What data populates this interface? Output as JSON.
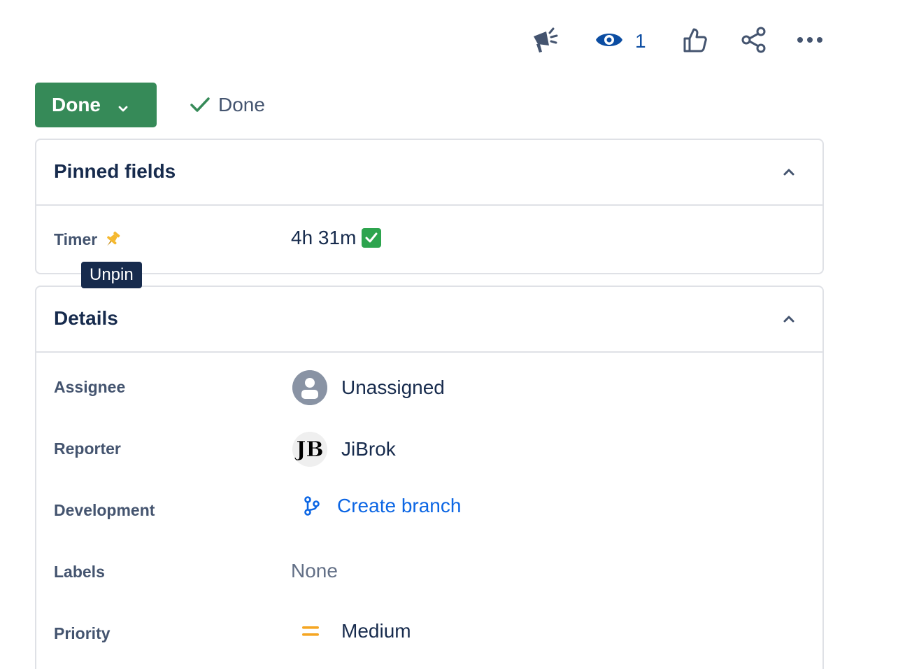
{
  "toolbar": {
    "feedback_icon": "megaphone-icon",
    "watch_icon": "eye-icon",
    "watch_count": "1",
    "like_icon": "thumbs-up-icon",
    "share_icon": "share-icon",
    "more_icon": "more-horizontal-icon"
  },
  "status": {
    "button_label": "Done",
    "resolution_label": "Done",
    "button_color": "#368a58",
    "check_color": "#368a58"
  },
  "pinned": {
    "title": "Pinned fields",
    "fields": {
      "timer": {
        "label": "Timer",
        "value": "4h 31m"
      }
    },
    "tooltip": "Unpin"
  },
  "details": {
    "title": "Details",
    "fields": {
      "assignee": {
        "label": "Assignee",
        "value": "Unassigned"
      },
      "reporter": {
        "label": "Reporter",
        "value": "JiBrok",
        "avatar_initials": "JB"
      },
      "development": {
        "label": "Development",
        "value": "Create branch"
      },
      "labels": {
        "label": "Labels",
        "value": "None"
      },
      "priority": {
        "label": "Priority",
        "value": "Medium",
        "color": "#f5a623"
      }
    }
  },
  "colors": {
    "link": "#0c66e4",
    "watch": "#0c4da2",
    "tooltip_bg": "#172b4d"
  }
}
